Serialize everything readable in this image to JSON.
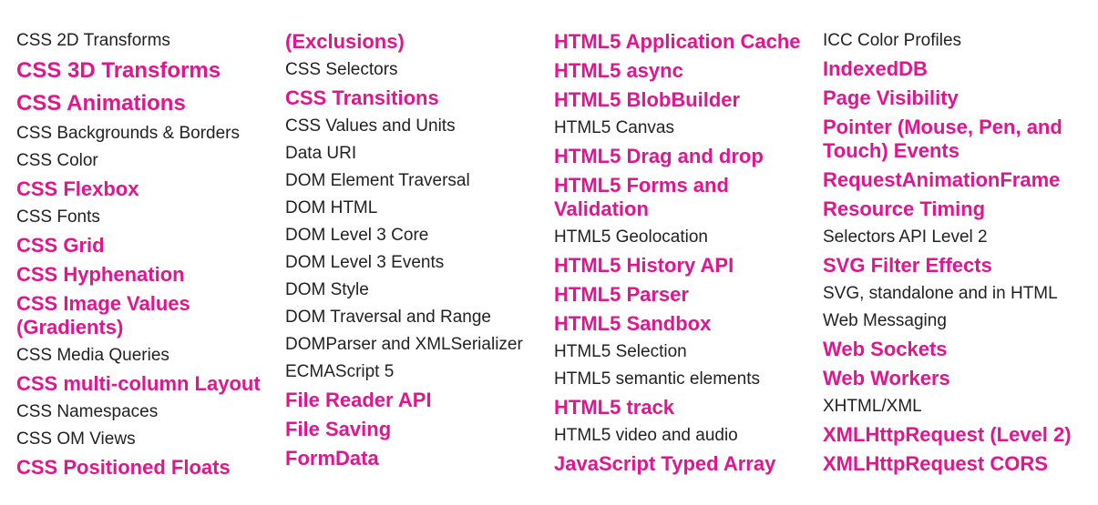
{
  "accent_color": "#e0168e",
  "text_color": "#222222",
  "columns": [
    {
      "items": [
        {
          "text": "CSS 2D Transforms",
          "style": "plain"
        },
        {
          "text": "CSS 3D Transforms",
          "style": "bold-large"
        },
        {
          "text": "CSS Animations",
          "style": "bold-large"
        },
        {
          "text": "CSS Backgrounds & Borders",
          "style": "plain"
        },
        {
          "text": "CSS Color",
          "style": "plain"
        },
        {
          "text": "CSS Flexbox",
          "style": "bold"
        },
        {
          "text": "CSS Fonts",
          "style": "plain"
        },
        {
          "text": "CSS Grid",
          "style": "bold"
        },
        {
          "text": "CSS Hyphenation",
          "style": "bold"
        },
        {
          "text": "CSS Image Values (Gradients)",
          "style": "bold"
        },
        {
          "text": "CSS Media Queries",
          "style": "plain"
        },
        {
          "text": "CSS multi-column Layout",
          "style": "bold"
        },
        {
          "text": "CSS Namespaces",
          "style": "plain"
        },
        {
          "text": "CSS OM Views",
          "style": "plain"
        },
        {
          "text": "CSS Positioned Floats",
          "style": "bold"
        }
      ]
    },
    {
      "items": [
        {
          "text": "(Exclusions)",
          "style": "bold"
        },
        {
          "text": "CSS Selectors",
          "style": "plain"
        },
        {
          "text": "CSS Transitions",
          "style": "bold"
        },
        {
          "text": "CSS Values and Units",
          "style": "plain"
        },
        {
          "text": "Data URI",
          "style": "plain"
        },
        {
          "text": "DOM Element Traversal",
          "style": "plain"
        },
        {
          "text": "DOM HTML",
          "style": "plain"
        },
        {
          "text": "DOM Level 3 Core",
          "style": "plain"
        },
        {
          "text": "DOM Level 3 Events",
          "style": "plain"
        },
        {
          "text": "DOM Style",
          "style": "plain"
        },
        {
          "text": "DOM Traversal and Range",
          "style": "plain"
        },
        {
          "text": "DOMParser and XMLSerializer",
          "style": "plain"
        },
        {
          "text": "ECMAScript 5",
          "style": "plain"
        },
        {
          "text": "File Reader API",
          "style": "bold"
        },
        {
          "text": "File Saving",
          "style": "bold"
        },
        {
          "text": "FormData",
          "style": "bold"
        }
      ]
    },
    {
      "items": [
        {
          "text": "HTML5 Application Cache",
          "style": "bold"
        },
        {
          "text": "HTML5 async",
          "style": "bold"
        },
        {
          "text": "HTML5 BlobBuilder",
          "style": "bold"
        },
        {
          "text": "HTML5 Canvas",
          "style": "plain"
        },
        {
          "text": "HTML5 Drag and drop",
          "style": "bold"
        },
        {
          "text": "HTML5 Forms and Validation",
          "style": "bold"
        },
        {
          "text": "HTML5 Geolocation",
          "style": "plain"
        },
        {
          "text": "HTML5 History API",
          "style": "bold"
        },
        {
          "text": "HTML5 Parser",
          "style": "bold"
        },
        {
          "text": "HTML5 Sandbox",
          "style": "bold"
        },
        {
          "text": "HTML5 Selection",
          "style": "plain"
        },
        {
          "text": "HTML5 semantic elements",
          "style": "plain"
        },
        {
          "text": "HTML5 track",
          "style": "bold"
        },
        {
          "text": "HTML5 video and audio",
          "style": "plain"
        },
        {
          "text": "JavaScript Typed Array",
          "style": "bold"
        }
      ]
    },
    {
      "items": [
        {
          "text": "ICC Color Profiles",
          "style": "plain"
        },
        {
          "text": "IndexedDB",
          "style": "bold"
        },
        {
          "text": "Page Visibility",
          "style": "bold"
        },
        {
          "text": "Pointer (Mouse, Pen, and Touch) Events",
          "style": "bold"
        },
        {
          "text": "RequestAnimationFrame",
          "style": "bold"
        },
        {
          "text": "Resource Timing",
          "style": "bold"
        },
        {
          "text": "Selectors API Level 2",
          "style": "plain"
        },
        {
          "text": "SVG Filter Effects",
          "style": "bold"
        },
        {
          "text": "SVG, standalone and in HTML",
          "style": "plain"
        },
        {
          "text": "Web Messaging",
          "style": "plain"
        },
        {
          "text": "Web Sockets",
          "style": "bold"
        },
        {
          "text": "Web Workers",
          "style": "bold"
        },
        {
          "text": "XHTML/XML",
          "style": "plain"
        },
        {
          "text": "XMLHttpRequest (Level 2)",
          "style": "bold"
        },
        {
          "text": "XMLHttpRequest CORS",
          "style": "bold"
        }
      ]
    }
  ]
}
